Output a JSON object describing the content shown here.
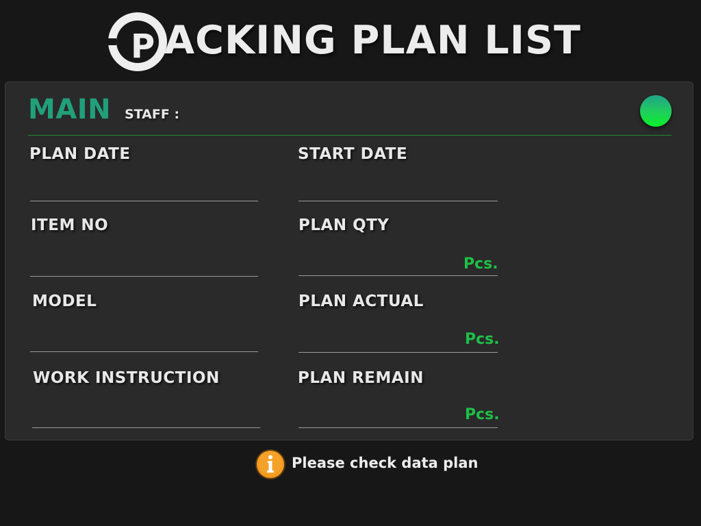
{
  "header": {
    "title_rest": "ACKING PLAN LIST",
    "logo_letter": "P"
  },
  "panel": {
    "title": "MAIN",
    "staff_label": "STAFF :",
    "status_color": "#12e13a"
  },
  "fields": {
    "plan_date": {
      "label": "PLAN DATE",
      "value": ""
    },
    "start_date": {
      "label": "START DATE",
      "value": ""
    },
    "item_no": {
      "label": "ITEM NO",
      "value": ""
    },
    "plan_qty": {
      "label": "PLAN QTY",
      "value": "",
      "unit": "Pcs."
    },
    "model": {
      "label": "MODEL",
      "value": ""
    },
    "plan_actual": {
      "label": "PLAN ACTUAL",
      "value": "",
      "unit": "Pcs."
    },
    "work_instruction": {
      "label": "WORK INSTRUCTION",
      "value": ""
    },
    "plan_remain": {
      "label": "PLAN REMAIN",
      "value": "",
      "unit": "Pcs."
    }
  },
  "notice": {
    "icon": "info-icon",
    "text": "Please check data plan"
  },
  "colors": {
    "background": "#171717",
    "panel": "#2a2a2a",
    "accent_green": "#21a07a",
    "unit_green": "#1ec047",
    "notice_orange": "#f39a1e"
  }
}
